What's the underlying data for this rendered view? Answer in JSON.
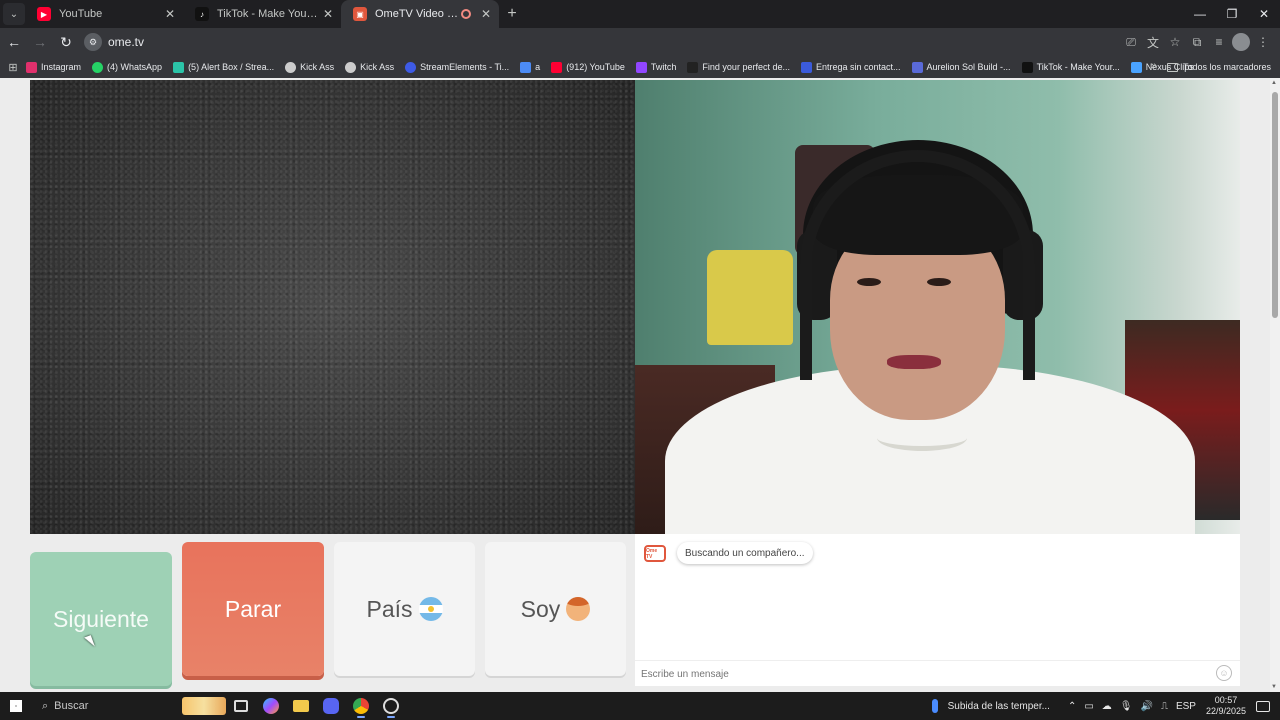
{
  "browser": {
    "tabs": [
      {
        "title": "YouTube",
        "favicon_color": "#ff0033",
        "active": false
      },
      {
        "title": "TikTok - Make Your Day",
        "favicon_color": "#111111",
        "active": false
      },
      {
        "title": "OmeTV Video Chat — Om",
        "favicon_color": "#e0573d",
        "active": true,
        "recording": true
      }
    ],
    "url": "ome.tv",
    "bookmarks": [
      {
        "label": "Instagram",
        "color": "#e1306c"
      },
      {
        "label": "(4) WhatsApp",
        "color": "#25d366"
      },
      {
        "label": "(5) Alert Box / Strea...",
        "color": "#2bc4a8"
      },
      {
        "label": "Kick Ass",
        "color": "#cccccc"
      },
      {
        "label": "Kick Ass",
        "color": "#cccccc"
      },
      {
        "label": "StreamElements - Ti...",
        "color": "#3e5be6"
      },
      {
        "label": "a",
        "color": "#4c8bf5"
      },
      {
        "label": "(912) YouTube",
        "color": "#ff0033"
      },
      {
        "label": "Twitch",
        "color": "#9146ff"
      },
      {
        "label": "Find your perfect de...",
        "color": "#222222"
      },
      {
        "label": "Entrega sin contact...",
        "color": "#3b5bdb"
      },
      {
        "label": "Aurelion Sol Build -...",
        "color": "#5a6ad8"
      },
      {
        "label": "TikTok - Make Your...",
        "color": "#111111"
      },
      {
        "label": "Nexus Clips",
        "color": "#4aa3ff"
      }
    ],
    "all_bookmarks_label": "Todos los marcadores"
  },
  "ometv": {
    "buttons": {
      "next": "Siguiente",
      "stop": "Parar",
      "country": "País",
      "me": "Soy"
    },
    "chat": {
      "logo_text": "Ome TV",
      "status_message": "Buscando un compañero...",
      "input_placeholder": "Escribe un mensaje"
    }
  },
  "taskbar": {
    "search_placeholder": "Buscar",
    "weather": "Subida de las temper...",
    "language": "ESP",
    "time": "00:57",
    "date": "22/9/2025"
  }
}
